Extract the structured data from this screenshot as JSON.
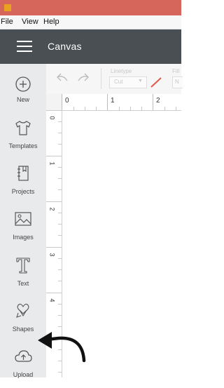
{
  "menu": {
    "items": [
      "File",
      "View",
      "Help"
    ]
  },
  "app": {
    "title": "Canvas"
  },
  "sidebar": {
    "items": [
      {
        "label": "New",
        "icon": "plus-circle-icon"
      },
      {
        "label": "Templates",
        "icon": "tshirt-icon"
      },
      {
        "label": "Projects",
        "icon": "notebook-icon"
      },
      {
        "label": "Images",
        "icon": "image-icon"
      },
      {
        "label": "Text",
        "icon": "text-t-icon"
      },
      {
        "label": "Shapes",
        "icon": "shapes-icon"
      },
      {
        "label": "Upload",
        "icon": "cloud-upload-icon"
      }
    ]
  },
  "toolbar": {
    "linetype_label": "Linetype",
    "linetype_value": "Cut",
    "fill_label": "Fill",
    "fill_value": "N"
  },
  "ruler": {
    "horizontal": [
      "0",
      "1",
      "2"
    ],
    "vertical": [
      "0",
      "1",
      "2",
      "3",
      "4"
    ]
  },
  "colors": {
    "titlebar": "#d6665b",
    "appbar": "#4a4f54",
    "sidebar": "#e9eaeb",
    "linetype_pen": "#e2574c"
  }
}
